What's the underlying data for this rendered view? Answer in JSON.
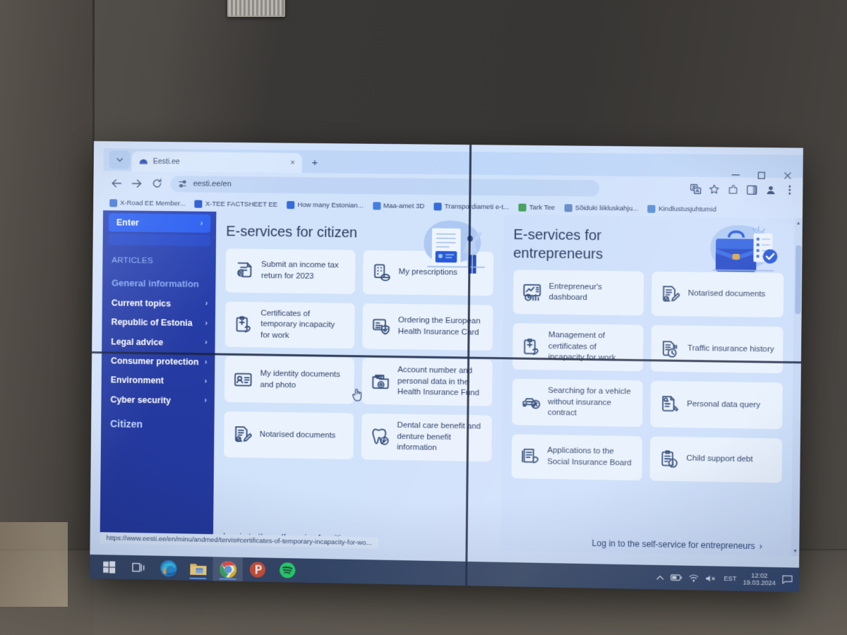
{
  "scene": {
    "description": "photo of a 2x2 video wall displaying a Chrome browser on eesti.ee"
  },
  "browser": {
    "tab": {
      "title": "Eesti.ee",
      "favicon": "eesti-logo-icon",
      "close_label": "×"
    },
    "new_tab_label": "+",
    "tab_search_icon": "chevron-down-icon",
    "window_controls": {
      "minimize": "–",
      "maximize": "❐",
      "close": "✕"
    },
    "nav": {
      "back": "←",
      "forward": "→",
      "reload": "↻"
    },
    "omnibox": {
      "value": "eesti.ee/en",
      "site_settings_icon": "tune-icon"
    },
    "toolbar_icons": [
      "translate-icon",
      "bookmark-star-icon",
      "extensions-icon",
      "side-panel-icon",
      "profile-icon",
      "more-menu-icon"
    ],
    "bookmarks": [
      {
        "label": "X-Road EE Member...",
        "icon": "globe-icon",
        "color": "#3b6fd4"
      },
      {
        "label": "X-TEE FACTSHEET EE",
        "icon": "x-tee-icon",
        "color": "#1b4fd0"
      },
      {
        "label": "How many Estonian...",
        "icon": "database-icon",
        "color": "#2a63d8"
      },
      {
        "label": "Maa-amet 3D",
        "icon": "map-icon",
        "color": "#3a78dd"
      },
      {
        "label": "Transpordiameti e-t...",
        "icon": "database-icon",
        "color": "#2a63d8"
      },
      {
        "label": "Tark Tee",
        "icon": "green-square-icon",
        "color": "#3f9b54"
      },
      {
        "label": "Sõiduki liikluskahju...",
        "icon": "shell-icon",
        "color": "#5f86c4"
      },
      {
        "label": "Kindlustusjuhtumid",
        "icon": "globe-icon",
        "color": "#4f88d3"
      }
    ],
    "status_bar_url": "https://www.eesti.ee/en/minu/andmed/tervis#certificates-of-temporary-incapacity-for-wo..."
  },
  "sidebar": {
    "enter_button": {
      "label": "Enter",
      "chevron": "›"
    },
    "section_label": "ARTICLES",
    "heading": "General information",
    "items": [
      {
        "label": "Current topics",
        "chevron": "›"
      },
      {
        "label": "Republic of Estonia",
        "chevron": "›"
      },
      {
        "label": "Legal advice",
        "chevron": "›"
      },
      {
        "label": "Consumer protection",
        "chevron": "›"
      },
      {
        "label": "Environment",
        "chevron": "›"
      },
      {
        "label": "Cyber security",
        "chevron": "›"
      }
    ],
    "footer_label": "Citizen"
  },
  "citizen": {
    "title": "E-services for citizen",
    "hero_icon": "person-with-document-illustration",
    "cards": [
      {
        "label": "Submit an income tax return for 2023",
        "icon": "document-euro-icon"
      },
      {
        "label": "My prescriptions",
        "icon": "pills-icon"
      },
      {
        "label": "Certificates of temporary incapacity for work",
        "icon": "clipboard-health-icon"
      },
      {
        "label": "Ordering the European Health Insurance Card",
        "icon": "card-shield-icon"
      },
      {
        "label": "My identity documents and photo",
        "icon": "id-card-icon"
      },
      {
        "label": "Account number and personal data in the Health Insurance Fund",
        "icon": "folder-data-icon"
      },
      {
        "label": "Notarised documents",
        "icon": "signed-document-icon"
      },
      {
        "label": "Dental care benefit and denture benefit information",
        "icon": "tooth-check-icon"
      }
    ],
    "footer_link": {
      "label": "Log in to the self-service for citizen",
      "chevron": "›"
    }
  },
  "entrepreneurs": {
    "title": "E-services for entrepreneurs",
    "hero_icon": "briefcase-checklist-illustration",
    "cards": [
      {
        "label": "Entrepreneur's dashboard",
        "icon": "chart-dashboard-icon"
      },
      {
        "label": "Notarised documents",
        "icon": "signed-document-icon"
      },
      {
        "label": "Management of certificates of incapacity for work",
        "icon": "clipboard-health-icon"
      },
      {
        "label": "Traffic insurance history",
        "icon": "document-clock-icon"
      },
      {
        "label": "Searching for a vehicle without insurance contract",
        "icon": "car-cross-icon"
      },
      {
        "label": "Personal data query",
        "icon": "document-search-icon"
      },
      {
        "label": "Applications to the Social Insurance Board",
        "icon": "document-speech-icon"
      },
      {
        "label": "Child support debt",
        "icon": "clipboard-info-icon"
      }
    ],
    "footer_link": {
      "label": "Log in to the self-service for entrepreneurs",
      "chevron": "›"
    }
  },
  "scrollbar": {
    "up_arrow": "▲",
    "down_arrow": "▼"
  },
  "taskbar": {
    "items": [
      {
        "name": "start-button",
        "icon": "windows-logo-icon"
      },
      {
        "name": "task-view-button",
        "icon": "task-view-icon"
      },
      {
        "name": "edge-button",
        "icon": "edge-icon"
      },
      {
        "name": "file-explorer-button",
        "icon": "folder-icon"
      },
      {
        "name": "chrome-button",
        "icon": "chrome-icon"
      },
      {
        "name": "powerpoint-button",
        "icon": "powerpoint-icon"
      },
      {
        "name": "spotify-button",
        "icon": "spotify-icon"
      }
    ],
    "tray": {
      "overflow": "⌃",
      "battery_icon": "battery-icon",
      "network_icon": "wifi-icon",
      "volume_icon": "volume-muted-icon",
      "language": "EST",
      "time": "12:02",
      "date": "19.03.2024",
      "notification_icon": "notification-icon"
    }
  }
}
